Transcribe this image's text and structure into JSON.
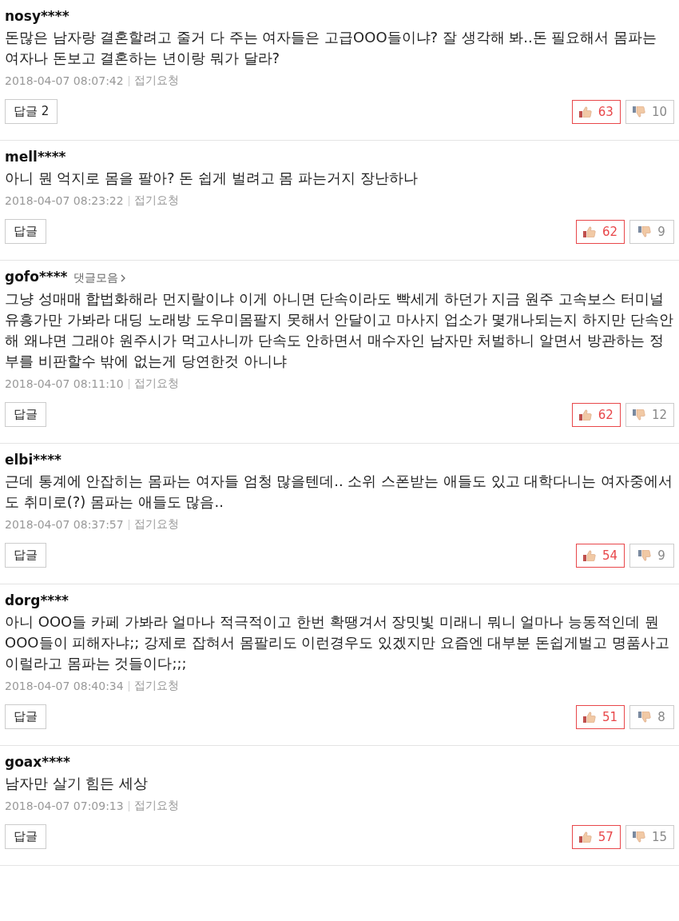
{
  "comments": [
    {
      "author": "nosy****",
      "text": "돈많은 남자랑 결혼할려고 줄거 다 주는 여자들은 고급OOO들이냐? 잘 생각해 봐..돈 필요해서 몸파는 여자나 돈보고 결혼하는 년이랑 뭐가 달라?",
      "date": "2018-04-07 08:07:42",
      "fold": "접기요청",
      "reply": "답글 2",
      "likes": "63",
      "dislikes": "10"
    },
    {
      "author": "mell****",
      "text": "아니 뭔 억지로 몸을 팔아? 돈 쉽게 벌려고 몸 파는거지 장난하나",
      "date": "2018-04-07 08:23:22",
      "fold": "접기요청",
      "reply": "답글",
      "likes": "62",
      "dislikes": "9"
    },
    {
      "author": "gofo****",
      "author_link": "댓글모음",
      "text": "그냥 성매매 합법화해라 먼지랄이냐 이게 아니면 단속이라도 빡세게 하던가 지금 원주 고속보스 터미널 유흥가만 가봐라 대딩 노래방 도우미몸팔지 못해서 안달이고 마사지 업소가 몇개나되는지 하지만 단속안해 왜냐면 그래야 원주시가 먹고사니까 단속도 안하면서 매수자인 남자만 처벌하니 알면서 방관하는 정부를 비판할수 밖에 없는게 당연한것 아니냐",
      "date": "2018-04-07 08:11:10",
      "fold": "접기요청",
      "reply": "답글",
      "likes": "62",
      "dislikes": "12"
    },
    {
      "author": "elbi****",
      "text": "근데 통계에 안잡히는 몸파는 여자들 엄청 많을텐데.. 소위 스폰받는 애들도 있고 대학다니는 여자중에서도 취미로(?) 몸파는 애들도 많음..",
      "date": "2018-04-07 08:37:57",
      "fold": "접기요청",
      "reply": "답글",
      "likes": "54",
      "dislikes": "9"
    },
    {
      "author": "dorg****",
      "text": "아니 OOO들 카페 가봐라 얼마나 적극적이고 한번 확땡겨서 장밋빛 미래니 뭐니 얼마나 능동적인데 뭔 OOO들이 피해자냐;; 강제로 잡혀서 몸팔리도 이런경우도 있겠지만 요즘엔 대부분 돈쉽게벌고 명품사고 이럴라고 몸파는 것들이다;;;",
      "date": "2018-04-07 08:40:34",
      "fold": "접기요청",
      "reply": "답글",
      "likes": "51",
      "dislikes": "8"
    },
    {
      "author": "goax****",
      "text": "남자만 살기 힘든 세상",
      "date": "2018-04-07 07:09:13",
      "fold": "접기요청",
      "reply": "답글",
      "likes": "57",
      "dislikes": "15"
    }
  ]
}
